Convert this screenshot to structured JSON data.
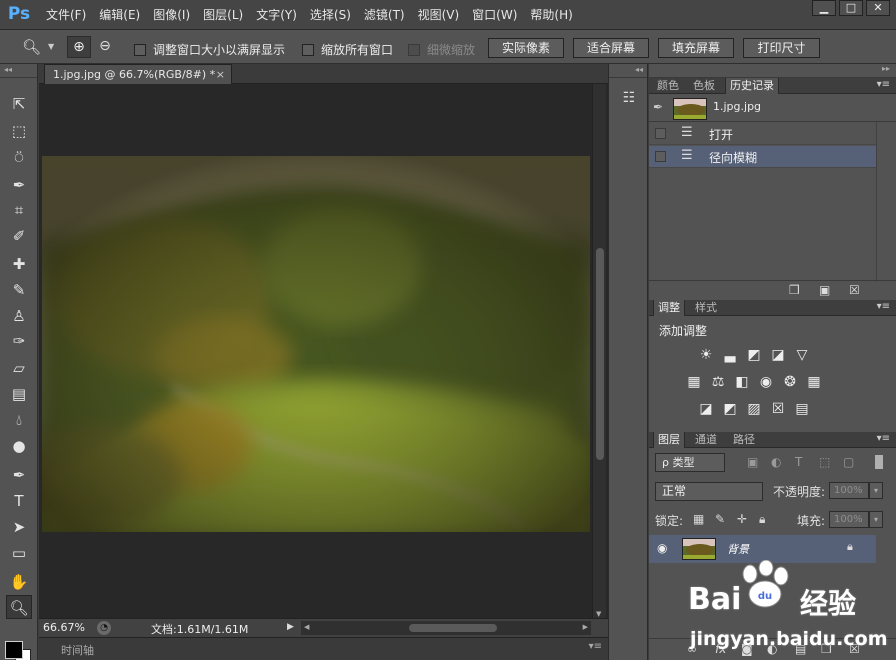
{
  "app": {
    "logo": "Ps"
  },
  "menu": [
    "文件(F)",
    "编辑(E)",
    "图像(I)",
    "图层(L)",
    "文字(Y)",
    "选择(S)",
    "滤镜(T)",
    "视图(V)",
    "窗口(W)",
    "帮助(H)"
  ],
  "window_controls": {
    "minimize": "▁",
    "maximize": "□",
    "close": "✕"
  },
  "options": {
    "tool_icon": "zoom-tool-icon",
    "zoom_in": "⊕",
    "zoom_out": "⊖",
    "resize_windows": "调整窗口大小以满屏显示",
    "zoom_all": "缩放所有窗口",
    "scrubby_zoom": "细微缩放",
    "actual_pixels": "实际像素",
    "fit_screen": "适合屏幕",
    "fill_screen": "填充屏幕",
    "print_size": "打印尺寸"
  },
  "document": {
    "tab_title": "1.jpg.jpg @ 66.7%(RGB/8#) *",
    "tab_close": "×",
    "zoom": "66.67%",
    "doc_size": "文档:1.61M/1.61M",
    "status_arrow": "▶"
  },
  "timeline": {
    "label": "时间轴"
  },
  "panels": {
    "history": {
      "tabs": [
        "颜色",
        "色板",
        "历史记录"
      ],
      "snapshot": "1.jpg.jpg",
      "items": [
        {
          "label": "打开",
          "selected": false
        },
        {
          "label": "径向模糊",
          "selected": true
        }
      ]
    },
    "adjustments": {
      "tabs": [
        "调整",
        "样式"
      ],
      "title": "添加调整"
    },
    "layers": {
      "tabs": [
        "图层",
        "通道",
        "路径"
      ],
      "filter": "ρ 类型",
      "blend_mode": "正常",
      "opacity_label": "不透明度:",
      "opacity_value": "100%",
      "lock_label": "锁定:",
      "fill_label": "填充:",
      "fill_value": "100%",
      "layer_name": "背景"
    }
  },
  "watermark": {
    "brand_left": "Bai",
    "brand_right": "经验",
    "url": "jingyan.baidu.com"
  },
  "colors": {
    "accent": "#5ab1ff",
    "selection": "#566177",
    "panel_bg": "#535353",
    "canvas_bg": "#282828"
  }
}
